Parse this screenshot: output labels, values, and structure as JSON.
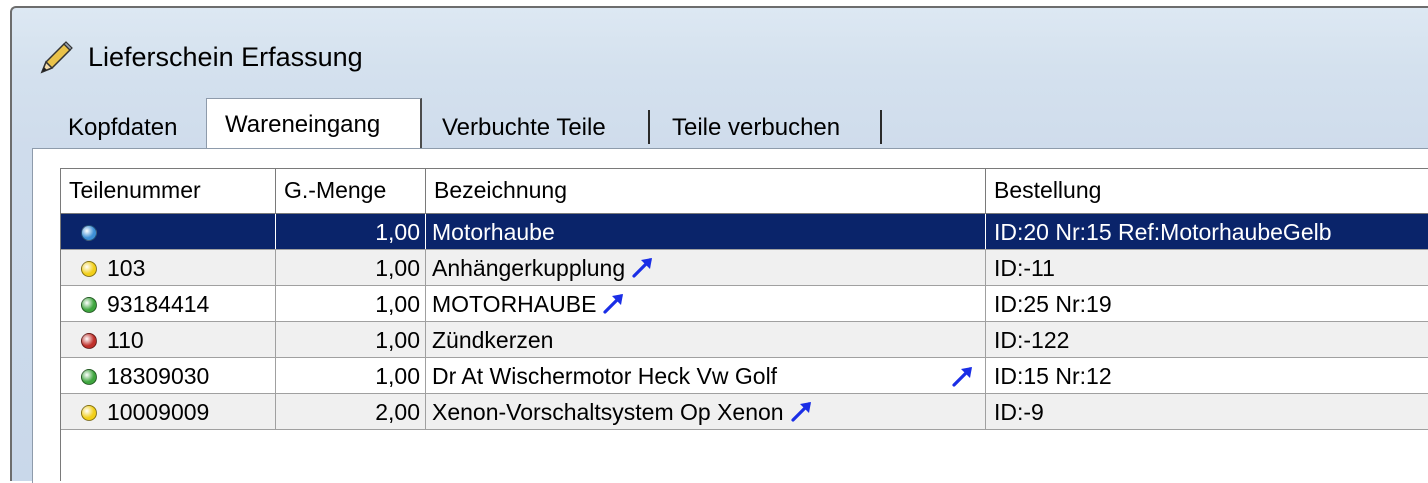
{
  "window": {
    "title": "Lieferschein Erfassung",
    "icon": "pencil-icon"
  },
  "tabs": [
    {
      "label": "Kopfdaten",
      "active": false
    },
    {
      "label": "Wareneingang",
      "active": true
    },
    {
      "label": "Verbuchte Teile",
      "active": false
    },
    {
      "label": "Teile verbuchen",
      "active": false
    }
  ],
  "grid": {
    "columns": [
      "Teilenummer",
      "G.-Menge",
      "Bezeichnung",
      "Bestellung"
    ],
    "rows": [
      {
        "status": "blue",
        "teilenummer": "",
        "menge": "1,00",
        "bezeichnung": "Motorhaube",
        "link": false,
        "bestellung": "ID:20 Nr:15 Ref:MotorhaubeGelb",
        "selected": true
      },
      {
        "status": "yellow",
        "teilenummer": "103",
        "menge": "1,00",
        "bezeichnung": "Anhängerkupplung",
        "link": true,
        "bestellung": "ID:-11",
        "selected": false
      },
      {
        "status": "green",
        "teilenummer": "93184414",
        "menge": "1,00",
        "bezeichnung": "MOTORHAUBE",
        "link": true,
        "bestellung": "ID:25 Nr:19",
        "selected": false
      },
      {
        "status": "red",
        "teilenummer": "110",
        "menge": "1,00",
        "bezeichnung": "Zündkerzen",
        "link": false,
        "bestellung": "ID:-122",
        "selected": false
      },
      {
        "status": "green",
        "teilenummer": "18309030",
        "menge": "1,00",
        "bezeichnung": "Dr At Wischermotor Heck Vw Golf",
        "link": true,
        "bestellung": "ID:15 Nr:12",
        "selected": false
      },
      {
        "status": "yellow",
        "teilenummer": "10009009",
        "menge": "2,00",
        "bezeichnung": "Xenon-Vorschaltsystem Op Xenon",
        "link": true,
        "bestellung": "ID:-9",
        "selected": false
      }
    ]
  },
  "colors": {
    "selection": "#0a246a",
    "status_blue": "#3d8fd6",
    "status_yellow": "#f2cf1a",
    "status_green": "#3fa63f",
    "status_red": "#c0302b",
    "link_arrow": "#1a2ee6"
  }
}
